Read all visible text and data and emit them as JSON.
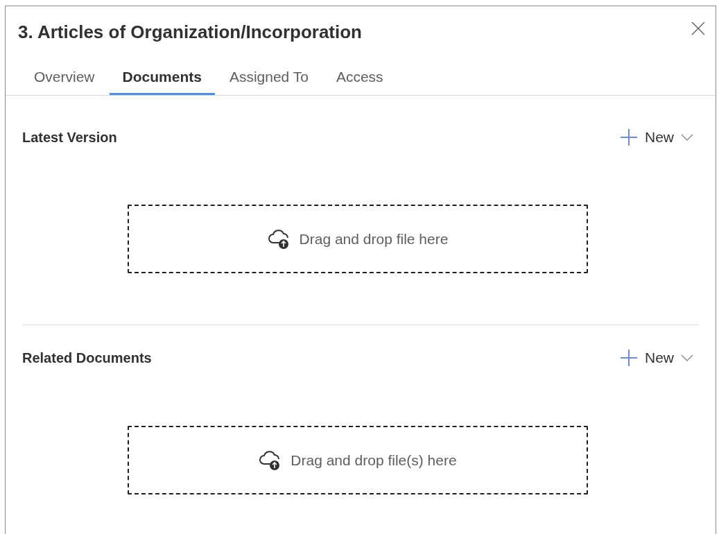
{
  "panel": {
    "title": "3. Articles of Organization/Incorporation"
  },
  "tabs": [
    {
      "label": "Overview",
      "selected": false
    },
    {
      "label": "Documents",
      "selected": true
    },
    {
      "label": "Assigned To",
      "selected": false
    },
    {
      "label": "Access",
      "selected": false
    }
  ],
  "sections": [
    {
      "heading": "Latest Version",
      "new_button": "New",
      "drop_zone": "Drag and drop file here"
    },
    {
      "heading": "Related Documents",
      "new_button": "New",
      "drop_zone": "Drag and drop file(s) here"
    }
  ]
}
